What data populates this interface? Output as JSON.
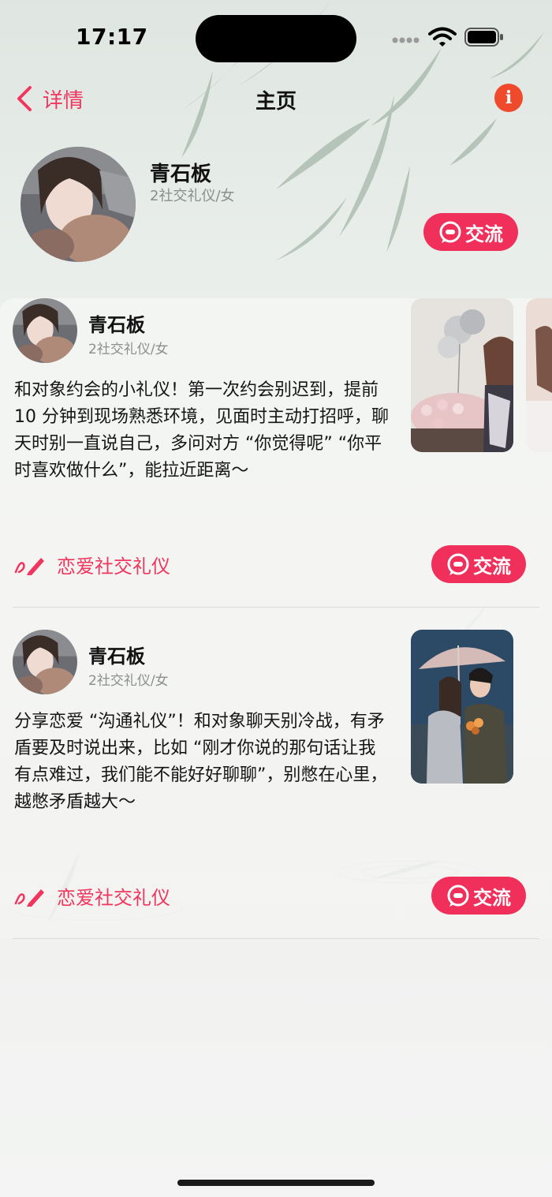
{
  "status_bar": {
    "time": "17:17"
  },
  "nav": {
    "back_label": "详情",
    "title": "主页"
  },
  "profile": {
    "name": "青石板",
    "subtitle": "2社交礼仪/女",
    "chat_label": "交流"
  },
  "posts": [
    {
      "name": "青石板",
      "subtitle": "2社交礼仪/女",
      "text": "和对象约会的小礼仪！第一次约会别迟到，提前 10 分钟到现场熟悉环境，见面时主动打招呼，聊天时别一直说自己，多问对方 “你觉得呢” “你平时喜欢做什么”，能拉近距离～",
      "tag": "恋爱社交礼仪",
      "chat_label": "交流"
    },
    {
      "name": "青石板",
      "subtitle": "2社交礼仪/女",
      "text": "分享恋爱 “沟通礼仪”！和对象聊天别冷战，有矛盾要及时说出来，比如 “刚才你说的那句话让我有点难过，我们能不能好好聊聊”，别憋在心里，越憋矛盾越大～",
      "tag": "恋爱社交礼仪",
      "chat_label": "交流"
    }
  ],
  "colors": {
    "accent": "#f0305a",
    "info": "#f04a2c",
    "text_secondary": "#8a8e8c"
  },
  "icons": {
    "back": "chevron-left-icon",
    "info": "info-icon",
    "chat": "chat-bubble-icon",
    "tag": "pen-icon"
  }
}
